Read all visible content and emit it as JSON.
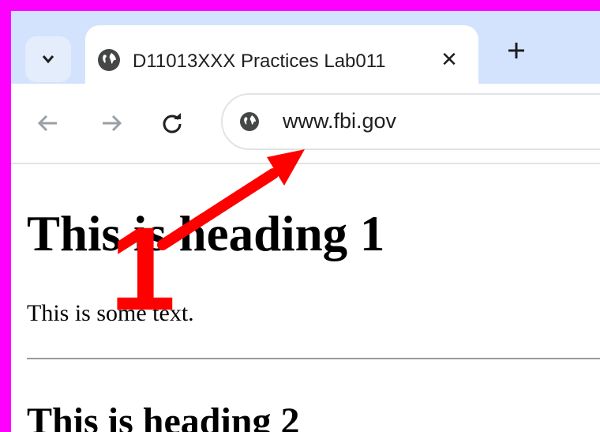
{
  "browser": {
    "tab": {
      "title": "D11013XXX Practices Lab011",
      "close": "✕"
    },
    "address_bar": {
      "url": "www.fbi.gov"
    }
  },
  "page": {
    "heading1": "This is heading 1",
    "paragraph": "This is some text.",
    "heading2": "This is heading 2"
  },
  "annotation": {
    "label": "1",
    "color": "#ff0000",
    "border_color": "#ff00ff"
  }
}
